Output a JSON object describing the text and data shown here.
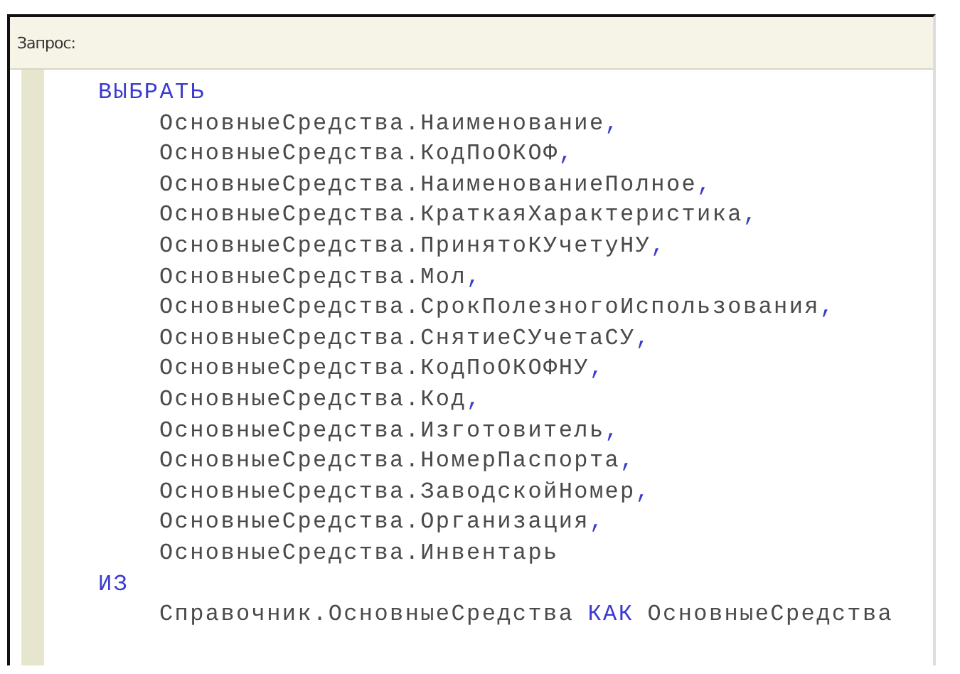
{
  "panel": {
    "label": "Запрос:"
  },
  "query": {
    "lines": [
      {
        "tokens": [
          {
            "kind": "keyword",
            "text": "ВЫБРАТЬ"
          }
        ],
        "children": [
          {
            "tokens": [
              {
                "kind": "ident",
                "text": "ОсновныеСредства.Наименование"
              },
              {
                "kind": "punct",
                "text": ","
              }
            ]
          },
          {
            "tokens": [
              {
                "kind": "ident",
                "text": "ОсновныеСредства.КодПоОКОФ"
              },
              {
                "kind": "punct",
                "text": ","
              }
            ]
          },
          {
            "tokens": [
              {
                "kind": "ident",
                "text": "ОсновныеСредства.НаименованиеПолное"
              },
              {
                "kind": "punct",
                "text": ","
              }
            ]
          },
          {
            "tokens": [
              {
                "kind": "ident",
                "text": "ОсновныеСредства.КраткаяХарактеристика"
              },
              {
                "kind": "punct",
                "text": ","
              }
            ]
          },
          {
            "tokens": [
              {
                "kind": "ident",
                "text": "ОсновныеСредства.ПринятоКУчетуНУ"
              },
              {
                "kind": "punct",
                "text": ","
              }
            ]
          },
          {
            "tokens": [
              {
                "kind": "ident",
                "text": "ОсновныеСредства.Мол"
              },
              {
                "kind": "punct",
                "text": ","
              }
            ]
          },
          {
            "tokens": [
              {
                "kind": "ident",
                "text": "ОсновныеСредства.СрокПолезногоИспользования"
              },
              {
                "kind": "punct",
                "text": ","
              }
            ]
          },
          {
            "tokens": [
              {
                "kind": "ident",
                "text": "ОсновныеСредства.СнятиеСУчетаСУ"
              },
              {
                "kind": "punct",
                "text": ","
              }
            ]
          },
          {
            "tokens": [
              {
                "kind": "ident",
                "text": "ОсновныеСредства.КодПоОКОФНУ"
              },
              {
                "kind": "punct",
                "text": ","
              }
            ]
          },
          {
            "tokens": [
              {
                "kind": "ident",
                "text": "ОсновныеСредства.Код"
              },
              {
                "kind": "punct",
                "text": ","
              }
            ]
          },
          {
            "tokens": [
              {
                "kind": "ident",
                "text": "ОсновныеСредства.Изготовитель"
              },
              {
                "kind": "punct",
                "text": ","
              }
            ]
          },
          {
            "tokens": [
              {
                "kind": "ident",
                "text": "ОсновныеСредства.НомерПаспорта"
              },
              {
                "kind": "punct",
                "text": ","
              }
            ]
          },
          {
            "tokens": [
              {
                "kind": "ident",
                "text": "ОсновныеСредства.ЗаводскойНомер"
              },
              {
                "kind": "punct",
                "text": ","
              }
            ]
          },
          {
            "tokens": [
              {
                "kind": "ident",
                "text": "ОсновныеСредства.Организация"
              },
              {
                "kind": "punct",
                "text": ","
              }
            ]
          },
          {
            "tokens": [
              {
                "kind": "ident",
                "text": "ОсновныеСредства.Инвентарь"
              }
            ]
          }
        ]
      },
      {
        "tokens": [
          {
            "kind": "keyword",
            "text": "ИЗ"
          }
        ],
        "children": [
          {
            "tokens": [
              {
                "kind": "ident",
                "text": "Справочник.ОсновныеСредства"
              },
              {
                "kind": "keyword",
                "text": "КАК"
              },
              {
                "kind": "ident",
                "text": "ОсновныеСредства"
              }
            ]
          }
        ]
      }
    ]
  }
}
